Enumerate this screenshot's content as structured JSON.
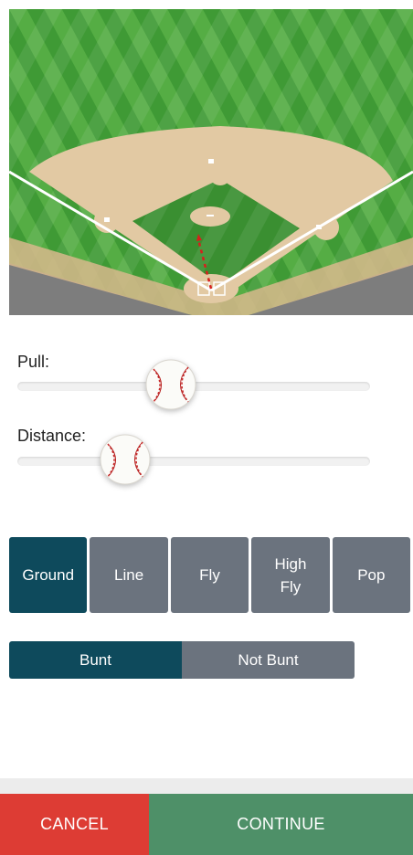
{
  "field": {
    "icon": "baseball-field-diagram",
    "colors": {
      "grass": "#3f9a35",
      "grass_stripe": "#5cb447",
      "dirt": "#e2c9a3",
      "trajectory": "#d6201c"
    }
  },
  "sliders": {
    "pull": {
      "label": "Pull:",
      "value": 0.44,
      "icon": "baseball-icon"
    },
    "distance": {
      "label": "Distance:",
      "value": 0.31,
      "icon": "baseball-icon"
    }
  },
  "hit_types": [
    {
      "label": "Ground",
      "selected": true
    },
    {
      "label": "Line",
      "selected": false
    },
    {
      "label": "Fly",
      "selected": false
    },
    {
      "label": "High\nFly",
      "selected": false
    },
    {
      "label": "Pop",
      "selected": false
    }
  ],
  "bunt": [
    {
      "label": "Bunt",
      "selected": true
    },
    {
      "label": "Not Bunt",
      "selected": false
    }
  ],
  "actions": {
    "cancel_label": "CANCEL",
    "continue_label": "CONTINUE"
  },
  "colors": {
    "selected": "#0e4a5c",
    "unselected": "#6b737e",
    "cancel": "#dd3c34",
    "continue": "#4e9068"
  }
}
